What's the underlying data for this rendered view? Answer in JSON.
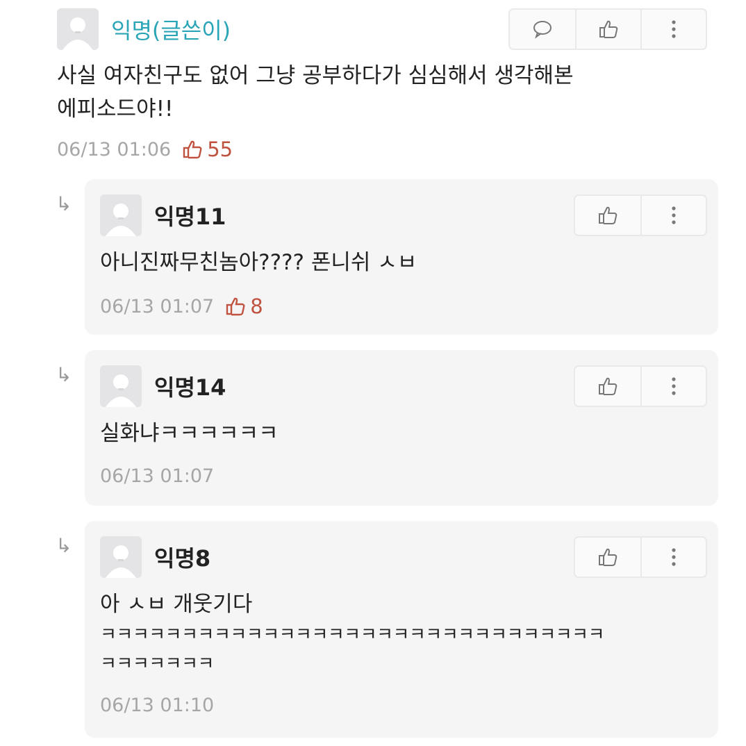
{
  "post": {
    "author": "익명(글쓴이)",
    "text_line1": "사실 여자친구도 없어 그냥 공부하다가 심심해서 생각해본",
    "text_line2": "에피소드야!!",
    "timestamp": "06/13 01:06",
    "likes": "55",
    "actions": [
      "comment-icon",
      "thumbs-up-icon",
      "more-vertical-icon"
    ]
  },
  "replies": [
    {
      "author": "익명11",
      "lines": [
        "아니진짜무친놈아???? 폰니쉬 ㅅㅂ"
      ],
      "timestamp": "06/13 01:07",
      "likes": "8",
      "actions": [
        "thumbs-up-icon",
        "more-vertical-icon"
      ]
    },
    {
      "author": "익명14",
      "lines": [
        "실화냐ㅋㅋㅋㅋㅋㅋ"
      ],
      "timestamp": "06/13 01:07",
      "actions": [
        "thumbs-up-icon",
        "more-vertical-icon"
      ]
    },
    {
      "author": "익명8",
      "lines": [
        "아 ㅅㅂ 개웃기다",
        "ㅋㅋㅋㅋㅋㅋㅋㅋㅋㅋㅋㅋㅋㅋㅋㅋㅋㅋㅋㅋㅋㅋㅋㅋㅋㅋㅋㅋㅋㅋㅋ",
        "ㅋㅋㅋㅋㅋㅋㅋ"
      ],
      "timestamp": "06/13 01:10",
      "actions": [
        "thumbs-up-icon",
        "more-vertical-icon"
      ]
    }
  ],
  "reply_arrow_glyph": "↳",
  "colors": {
    "op_name": "#2aa5b7",
    "like_count": "#c0533f",
    "meta_gray": "#a6a6a6",
    "card_bg": "#f5f5f6"
  }
}
